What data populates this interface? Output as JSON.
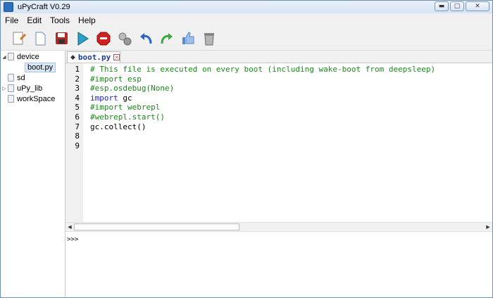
{
  "window": {
    "title": "uPyCraft V0.29",
    "min": "▬",
    "max": "▢",
    "close": "✕"
  },
  "menu": [
    "File",
    "Edit",
    "Tools",
    "Help"
  ],
  "toolbar": [
    {
      "name": "new-file-button",
      "icon": "new-document-icon",
      "color": "#d07a2a"
    },
    {
      "name": "open-button",
      "icon": "open-document-icon",
      "color": "#6f8fb0"
    },
    {
      "name": "save-button",
      "icon": "floppy-disk-icon",
      "color": "#b02a2a"
    },
    {
      "name": "run-button",
      "icon": "play-icon",
      "color": "#2aa0c8"
    },
    {
      "name": "stop-button",
      "icon": "stop-sign-icon",
      "color": "#d02020"
    },
    {
      "name": "connect-button",
      "icon": "plug-icon",
      "color": "#8a8a8a"
    },
    {
      "name": "undo-button",
      "icon": "undo-arrow-icon",
      "color": "#2a60c8"
    },
    {
      "name": "redo-button",
      "icon": "redo-arrow-icon",
      "color": "#3aa83a"
    },
    {
      "name": "sync-button",
      "icon": "thumbs-up-icon",
      "color": "#5a8ac8"
    },
    {
      "name": "clear-button",
      "icon": "trash-icon",
      "color": "#7a7a7a"
    }
  ],
  "tree": [
    {
      "label": "device",
      "arrow": "◢",
      "level": 0,
      "selected": false
    },
    {
      "label": "boot.py",
      "arrow": "",
      "level": 1,
      "selected": true
    },
    {
      "label": "sd",
      "arrow": "",
      "level": 0,
      "selected": false
    },
    {
      "label": "uPy_lib",
      "arrow": "▷",
      "level": 0,
      "selected": false
    },
    {
      "label": "workSpace",
      "arrow": "",
      "level": 0,
      "selected": false
    }
  ],
  "tab": {
    "label": "boot.py",
    "close": "✕"
  },
  "code_lines": [
    {
      "n": "1",
      "text": "# This file is executed on every boot (including wake-boot from deepsleep)",
      "kind": "comment"
    },
    {
      "n": "2",
      "text": "#import esp",
      "kind": "comment"
    },
    {
      "n": "3",
      "text": "#esp.osdebug(None)",
      "kind": "comment"
    },
    {
      "n": "4",
      "text": "",
      "kind": "import",
      "kw": "import",
      "rest": " gc"
    },
    {
      "n": "5",
      "text": "#import webrepl",
      "kind": "comment"
    },
    {
      "n": "6",
      "text": "#webrepl.start()",
      "kind": "comment"
    },
    {
      "n": "7",
      "text": "gc.collect()",
      "kind": "plain"
    },
    {
      "n": "8",
      "text": "",
      "kind": "plain"
    },
    {
      "n": "9",
      "text": "",
      "kind": "plain"
    }
  ],
  "console": {
    "prompt": ">>>"
  },
  "scroll": {
    "left": "◀",
    "right": "▶"
  }
}
